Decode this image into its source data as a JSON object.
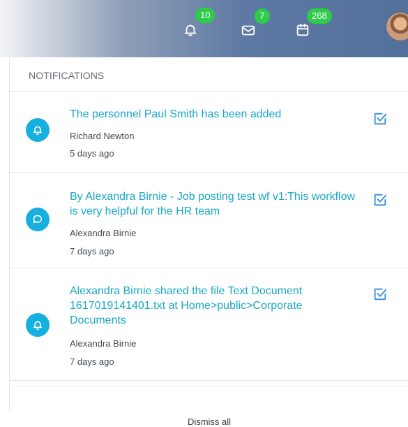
{
  "topbar": {
    "icons": [
      "bell-icon",
      "mail-icon",
      "calendar-icon"
    ],
    "notification_count": "10",
    "message_count": "7",
    "calendar_count": "268",
    "badge_color": "#2ecc4a"
  },
  "panel": {
    "title": "NOTIFICATIONS",
    "dismiss_label": "Dismiss all",
    "accent_color": "#17aee0",
    "link_color": "#18a8c7"
  },
  "notifications": [
    {
      "icon": "bell-icon",
      "text": "The personnel Paul Smith has been added",
      "author": "Richard Newton",
      "time": "5 days ago"
    },
    {
      "icon": "comment-icon",
      "text": "By Alexandra Birnie - Job posting test wf v1:This workflow is very helpful for the HR team",
      "author": "Alexandra Birnie",
      "time": "7 days ago"
    },
    {
      "icon": "bell-icon",
      "text": "Alexandra Birnie shared the file Text Document 1617019141401.txt at Home>public>Corporate Documents",
      "author": "Alexandra Birnie",
      "time": "7 days ago"
    }
  ]
}
